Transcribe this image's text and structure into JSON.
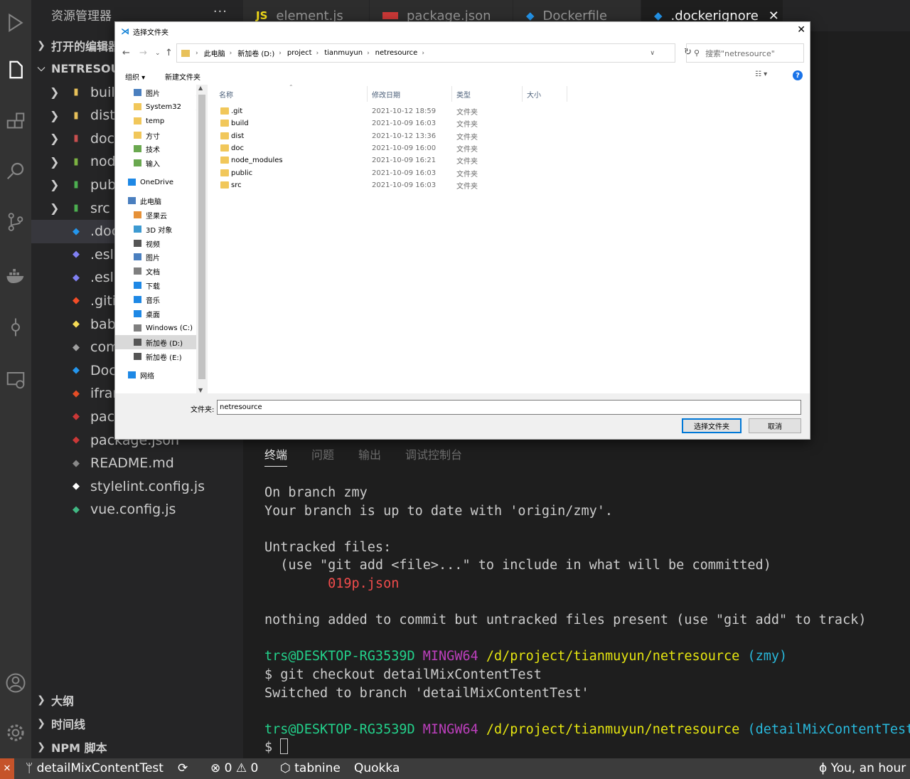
{
  "activity_bar": {
    "icons": [
      "run-debug-icon",
      "files-icon",
      "extensions-icon",
      "search-icon",
      "source-control-icon",
      "docker-icon",
      "git-graph-icon",
      "remote-explorer-icon",
      "account-icon",
      "settings-gear-icon"
    ]
  },
  "sidebar": {
    "title": "资源管理器",
    "more": "···",
    "open_editors": "打开的编辑器",
    "project": "NETRESOURCE",
    "items": [
      {
        "name": "build",
        "type": "folder",
        "icon_color": "#e8c15a"
      },
      {
        "name": "dist",
        "type": "folder",
        "icon_color": "#e8c15a"
      },
      {
        "name": "doc",
        "type": "folder",
        "icon_color": "#c94f4f"
      },
      {
        "name": "node_modules",
        "type": "folder",
        "icon_color": "#7cb342"
      },
      {
        "name": "public",
        "type": "folder",
        "icon_color": "#4caf50"
      },
      {
        "name": "src",
        "type": "folder",
        "icon_color": "#4caf50"
      },
      {
        "name": ".dockerignore",
        "type": "file",
        "icon_color": "#2496ed"
      },
      {
        "name": ".eslintignore",
        "type": "file",
        "icon_color": "#8080f2"
      },
      {
        "name": ".eslintrc.js",
        "type": "file",
        "icon_color": "#8080f2"
      },
      {
        "name": ".gitignore",
        "type": "file",
        "icon_color": "#f44d27"
      },
      {
        "name": "babel.config.js",
        "type": "file",
        "icon_color": "#f5da55"
      },
      {
        "name": "commitlint.config.js",
        "type": "file",
        "icon_color": "#a0a0a0"
      },
      {
        "name": "Dockerfile",
        "type": "file",
        "icon_color": "#2496ed"
      },
      {
        "name": "iframe.html",
        "type": "file",
        "icon_color": "#e44d26"
      },
      {
        "name": "package-lock.json",
        "type": "file",
        "icon_color": "#cb3837"
      },
      {
        "name": "package.json",
        "type": "file",
        "icon_color": "#cb3837"
      },
      {
        "name": "README.md",
        "type": "file",
        "icon_color": "#888888"
      },
      {
        "name": "stylelint.config.js",
        "type": "file",
        "icon_color": "#ffffff"
      },
      {
        "name": "vue.config.js",
        "type": "file",
        "icon_color": "#41b883"
      }
    ],
    "outline": "大纲",
    "timeline": "时间线",
    "npm_scripts": "NPM 脚本"
  },
  "tabs": [
    {
      "label": "element.js",
      "icon": "JS",
      "icon_color": "#f5de19"
    },
    {
      "label": "package.json",
      "icon": "npm",
      "icon_color": "#cb3837"
    },
    {
      "label": "Dockerfile",
      "icon": "docker",
      "icon_color": "#2496ed"
    },
    {
      "label": ".dockerignore",
      "icon": "docker",
      "icon_color": "#2496ed",
      "close": "✕"
    }
  ],
  "panel": {
    "tabs": [
      "终端",
      "问题",
      "输出",
      "调试控制台"
    ]
  },
  "terminal": {
    "line1": "On branch zmy",
    "line2": "Your branch is up to date with 'origin/zmy'.",
    "line3": "Untracked files:",
    "line4": "  (use \"git add <file>...\" to include in what will be committed)",
    "line5": "        019p.json",
    "line6": "nothing added to commit but untracked files present (use \"git add\" to track)",
    "prompt_user": "trs@DESKTOP-RG3539D",
    "prompt_env": "MINGW64",
    "prompt_path": "/d/project/tianmuyun/netresource",
    "prompt_branch1": "(zmy)",
    "command": "$ git checkout detailMixContentTest",
    "output": "Switched to branch 'detailMixContentTest'",
    "prompt_branch2": "(detailMixContentTest)",
    "dollar": "$"
  },
  "status_bar": {
    "branch": "detailMixContentTest",
    "errors": "0",
    "warnings": "0",
    "tabnine": "tabnine",
    "quokka": "Quokka",
    "blame": "You, an hour a"
  },
  "dialog": {
    "title": "选择文件夹",
    "breadcrumbs": [
      "此电脑",
      "新加卷 (D:)",
      "project",
      "tianmuyun",
      "netresource"
    ],
    "search_placeholder": "搜索\"netresource\"",
    "organize": "组织 ▾",
    "new_folder": "新建文件夹",
    "nav_items": [
      {
        "label": "图片",
        "pinned": true,
        "color": "#4a7fbf"
      },
      {
        "label": "System32",
        "pinned": true,
        "color": "#f1c75a"
      },
      {
        "label": "temp",
        "pinned": false,
        "color": "#f1c75a"
      },
      {
        "label": "方寸",
        "pinned": false,
        "color": "#f1c75a"
      },
      {
        "label": "技术",
        "pinned": false,
        "color": "#6aa84f"
      },
      {
        "label": "输入",
        "pinned": false,
        "color": "#6aa84f"
      },
      {
        "label": "OneDrive",
        "pinned": false,
        "color": "#1e88e5"
      },
      {
        "label": "此电脑",
        "pinned": false,
        "color": "#4a7fbf"
      },
      {
        "label": "坚果云",
        "pinned": false,
        "color": "#e69138"
      },
      {
        "label": "3D 对象",
        "pinned": false,
        "color": "#3d9ad1"
      },
      {
        "label": "视频",
        "pinned": false,
        "color": "#555555"
      },
      {
        "label": "图片",
        "pinned": false,
        "color": "#4a7fbf"
      },
      {
        "label": "文档",
        "pinned": false,
        "color": "#7f7f7f"
      },
      {
        "label": "下载",
        "pinned": false,
        "color": "#1e88e5"
      },
      {
        "label": "音乐",
        "pinned": false,
        "color": "#1e88e5"
      },
      {
        "label": "桌面",
        "pinned": false,
        "color": "#1e88e5"
      },
      {
        "label": "Windows (C:)",
        "pinned": false,
        "color": "#7f7f7f"
      },
      {
        "label": "新加卷 (D:)",
        "pinned": false,
        "color": "#555555"
      },
      {
        "label": "新加卷 (E:)",
        "pinned": false,
        "color": "#555555"
      },
      {
        "label": "网络",
        "pinned": false,
        "color": "#1e88e5"
      }
    ],
    "columns": {
      "name": "名称",
      "date": "修改日期",
      "type": "类型",
      "size": "大小"
    },
    "files": [
      {
        "name": ".git",
        "date": "2021-10-12 18:59",
        "type": "文件夹"
      },
      {
        "name": "build",
        "date": "2021-10-09 16:03",
        "type": "文件夹"
      },
      {
        "name": "dist",
        "date": "2021-10-12 13:36",
        "type": "文件夹"
      },
      {
        "name": "doc",
        "date": "2021-10-09 16:00",
        "type": "文件夹"
      },
      {
        "name": "node_modules",
        "date": "2021-10-09 16:21",
        "type": "文件夹"
      },
      {
        "name": "public",
        "date": "2021-10-09 16:03",
        "type": "文件夹"
      },
      {
        "name": "src",
        "date": "2021-10-09 16:03",
        "type": "文件夹"
      }
    ],
    "folder_label": "文件夹:",
    "folder_value": "netresource",
    "select_button": "选择文件夹",
    "cancel_button": "取消"
  }
}
